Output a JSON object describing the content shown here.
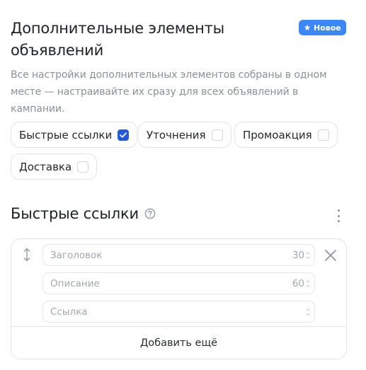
{
  "header": {
    "title": "Дополнительные элементы объявлений",
    "badge": "Новое",
    "badge_icon": "star-icon",
    "accent_color": "#3d86f5"
  },
  "description": "Все настройки дополнительных элементов собраны в одном месте — настраивайте их сразу для всех объявлений в кампании.",
  "chips": [
    {
      "label": "Быстрые ссылки",
      "checked": true
    },
    {
      "label": "Уточнения",
      "checked": false
    },
    {
      "label": "Промоакция",
      "checked": false
    },
    {
      "label": "Доставка",
      "checked": false
    }
  ],
  "section": {
    "title": "Быстрые ссылки",
    "help_icon": "question-circle-icon",
    "menu_icon": "kebab-menu-icon"
  },
  "quick_link": {
    "drag_icon": "drag-handle-icon",
    "remove_icon": "close-icon",
    "fields": [
      {
        "placeholder": "Заголовок",
        "counter": "30"
      },
      {
        "placeholder": "Описание",
        "counter": "60"
      },
      {
        "placeholder": "Ссылка",
        "counter": ""
      }
    ],
    "add_label": "Добавить ещё"
  },
  "colors": {
    "checkbox_checked": "#2758d6"
  }
}
